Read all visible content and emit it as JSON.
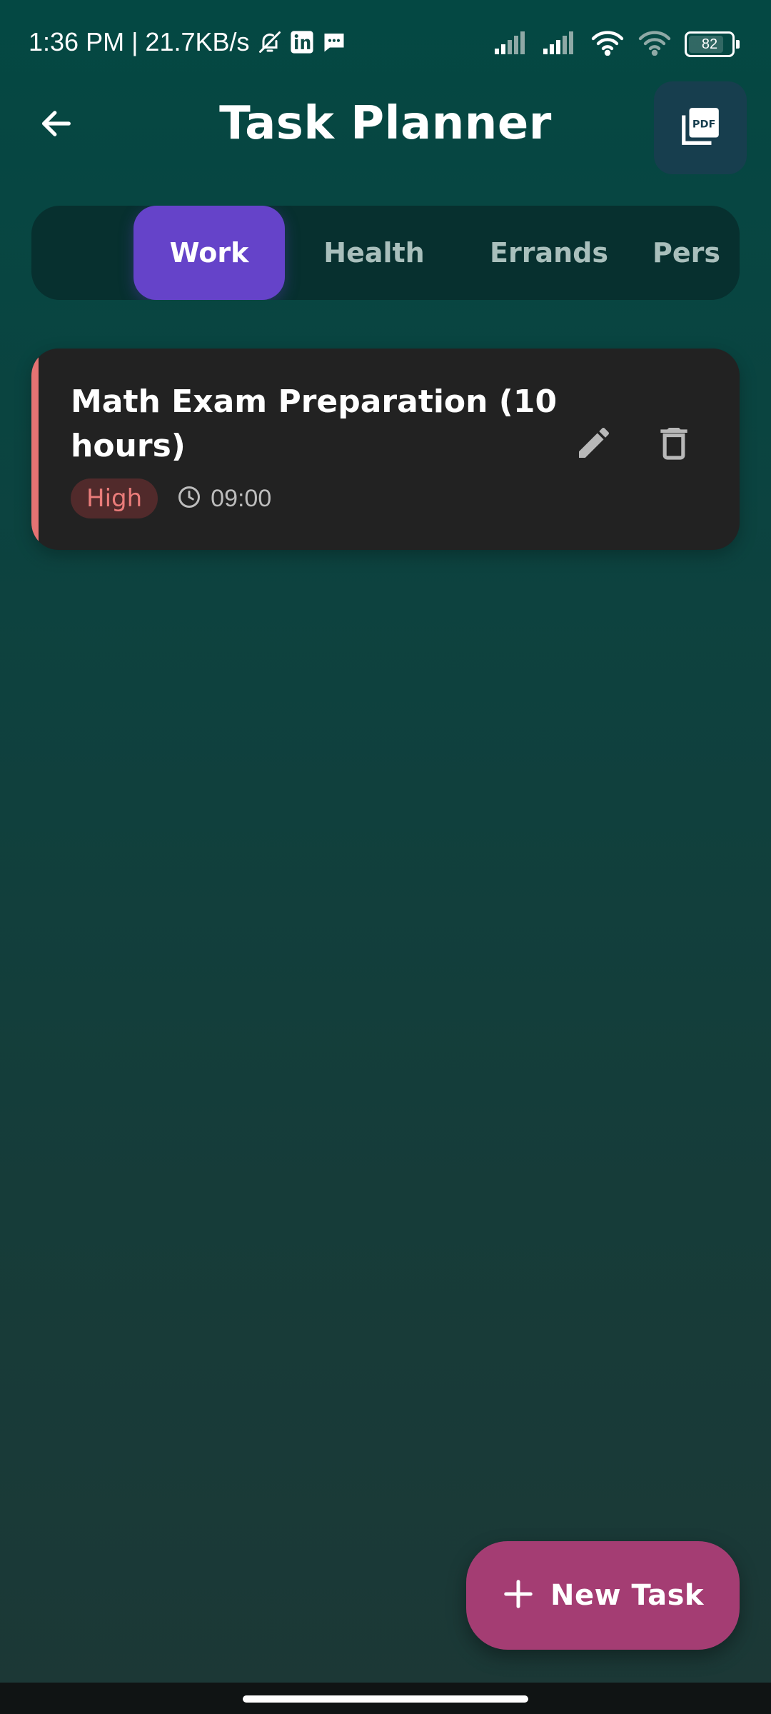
{
  "status_bar": {
    "time_speed": "1:36 PM | 21.7KB/s",
    "battery_level": "82",
    "icons": [
      "bell-off-icon",
      "linkedin-icon",
      "message-icon",
      "signal-icon",
      "signal-icon",
      "wifi-icon",
      "wifi-icon",
      "battery-icon"
    ]
  },
  "header": {
    "title": "Task Planner",
    "back_icon": "arrow-left-icon",
    "pdf_icon": "pdf-icon"
  },
  "tabs": [
    {
      "label": "Work",
      "active": true
    },
    {
      "label": "Health",
      "active": false
    },
    {
      "label": "Errands",
      "active": false
    },
    {
      "label": "Pers",
      "active": false
    }
  ],
  "tasks": [
    {
      "title": "Math Exam Preparation (10 hours)",
      "priority": "High",
      "time": "09:00",
      "accent_color": "#e57373"
    }
  ],
  "fab": {
    "label": "New Task",
    "icon": "plus-icon"
  },
  "colors": {
    "accent_tab": "#6543c9",
    "fab": "#a43d73",
    "priority_high": "#e57373",
    "card": "#222222"
  }
}
